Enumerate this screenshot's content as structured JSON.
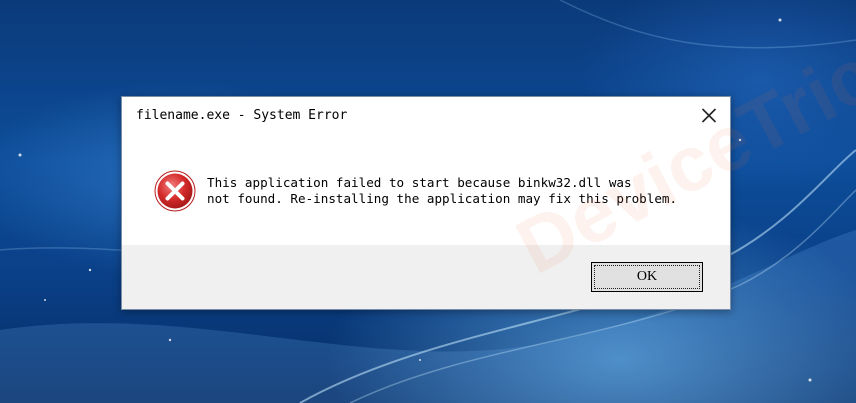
{
  "dialog": {
    "title": "filename.exe - System Error",
    "close_icon": "close-icon",
    "error_icon": "error-icon",
    "message_line1": "This application failed to start because binkw32.dll was",
    "message_line2": "not found. Re-installing the application may fix this problem.",
    "ok_label": "OK"
  },
  "watermark": {
    "text": "DeviceTricks"
  },
  "colors": {
    "error_red": "#d42a2a",
    "footer_bg": "#f0f0f0",
    "desktop_blue": "#0d4d9a"
  }
}
